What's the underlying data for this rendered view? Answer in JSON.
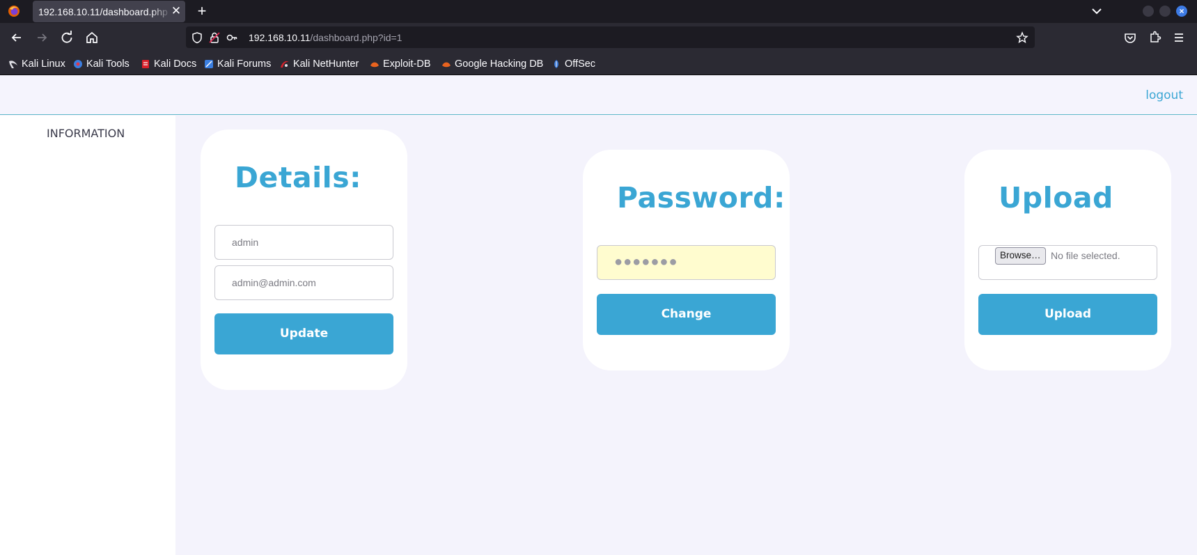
{
  "browser": {
    "tab_title": "192.168.10.11/dashboard.php",
    "tab_close": "✕",
    "new_tab": "+",
    "url_host": "192.168.10.11",
    "url_path": "/dashboard.php?id=1"
  },
  "bookmarks": [
    {
      "label": "Kali Linux",
      "icon": "kali-dragon-icon",
      "color": "#2f2f2f"
    },
    {
      "label": "Kali Tools",
      "icon": "kali-tools-icon",
      "color": "#3a7ee0"
    },
    {
      "label": "Kali Docs",
      "icon": "kali-docs-icon",
      "color": "#d9202a"
    },
    {
      "label": "Kali Forums",
      "icon": "kali-forums-icon",
      "color": "#3a7ee0"
    },
    {
      "label": "Kali NetHunter",
      "icon": "kali-nethunter-icon",
      "color": "#d9202a"
    },
    {
      "label": "Exploit-DB",
      "icon": "exploit-db-icon",
      "color": "#e8631f"
    },
    {
      "label": "Google Hacking DB",
      "icon": "ghdb-icon",
      "color": "#e8631f"
    },
    {
      "label": "OffSec",
      "icon": "offsec-icon",
      "color": "#3a7ee0"
    }
  ],
  "header": {
    "logout_label": "logout"
  },
  "sidebar": {
    "items": [
      {
        "label": "INFORMATION"
      }
    ]
  },
  "details": {
    "title": "Details:",
    "username_value": "admin",
    "email_value": "admin@admin.com",
    "button_label": "Update"
  },
  "password": {
    "title": "Password:",
    "masked_value": "●●●●●●●",
    "button_label": "Change"
  },
  "upload": {
    "title": "Upload",
    "browse_label": "Browse…",
    "no_file_label": "No file selected.",
    "button_label": "Upload"
  },
  "colors": {
    "accent": "#3aa6d4",
    "page_bg": "#f4f3fc",
    "autofill_bg": "#fffccf"
  }
}
